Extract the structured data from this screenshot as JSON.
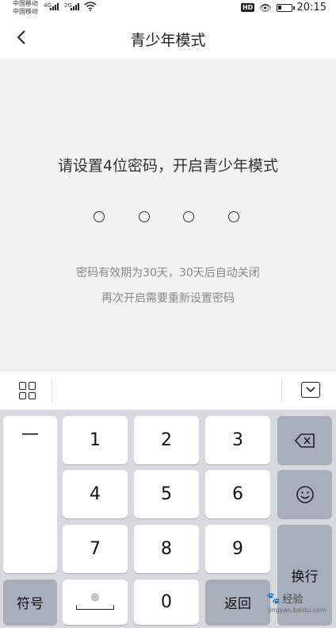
{
  "status_bar": {
    "carrier_1": "中国移动",
    "carrier_2": "中国移动",
    "signal_1": "4G",
    "signal_2": "2G",
    "hd": "HD",
    "time": "20:15"
  },
  "nav": {
    "back_icon": "chevron-left-icon",
    "back_glyph": "‹",
    "title": "青少年模式"
  },
  "main": {
    "prompt": "请设置4位密码，开启青少年模式",
    "pin_length": 4,
    "pin_filled": 0,
    "note_1": "密码有效期为30天，30天后自动关闭",
    "note_2": "再次开启需要重新设置密码"
  },
  "keyboard": {
    "toolbar_left_icon": "apps-grid-icon",
    "toolbar_right_icon": "hide-keyboard-icon",
    "dash": "—",
    "digits": [
      "1",
      "2",
      "3",
      "4",
      "5",
      "6",
      "7",
      "8",
      "9",
      "0"
    ],
    "backspace_icon": "backspace-icon",
    "emoji_icon": "emoji-icon",
    "enter": "换行",
    "symbols": "符号",
    "return": "返回",
    "mic_icon": "mic-icon",
    "space_icon": "space-bar-icon"
  },
  "watermark": {
    "text": "经验",
    "url": "jingyan.baidu.com",
    "icon": "paw-icon"
  },
  "colors": {
    "keyboard_bg": "#d7d9de",
    "function_key": "#a7afbb",
    "page_bg": "#f2f2f2"
  }
}
